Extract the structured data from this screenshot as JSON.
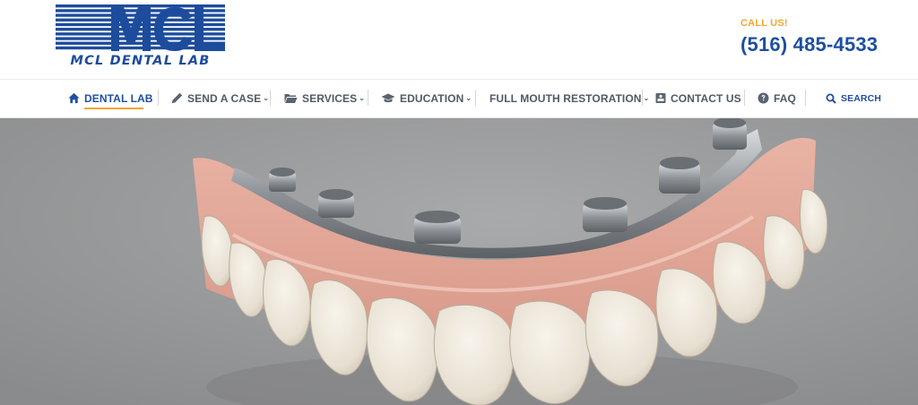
{
  "logo": {
    "letters": "MCL",
    "subtitle": "MCL DENTAL LAB"
  },
  "contact": {
    "label": "CALL US!",
    "phone": "(516) 485-4533"
  },
  "nav": {
    "items": [
      {
        "label": "DENTAL LAB",
        "icon": "home-icon",
        "active": true
      },
      {
        "label": "SEND A CASE",
        "icon": "pencil-icon",
        "dropdown": true
      },
      {
        "label": "SERVICES",
        "icon": "folder-icon",
        "dropdown": true
      },
      {
        "label": "EDUCATION",
        "icon": "graduation-cap-icon",
        "dropdown": true
      },
      {
        "label": "FULL MOUTH RESTORATION",
        "dropdown": true
      },
      {
        "label": "CONTACT US",
        "icon": "contact-card-icon"
      },
      {
        "label": "FAQ",
        "icon": "question-circle-icon"
      }
    ],
    "search_label": "SEARCH",
    "caret": "⌄"
  },
  "hero": {
    "image": "implant-supported-denture-photo"
  },
  "colors": {
    "brand_blue": "#1e4f9f",
    "accent_orange": "#f3a632",
    "nav_text": "#4f5a66"
  }
}
